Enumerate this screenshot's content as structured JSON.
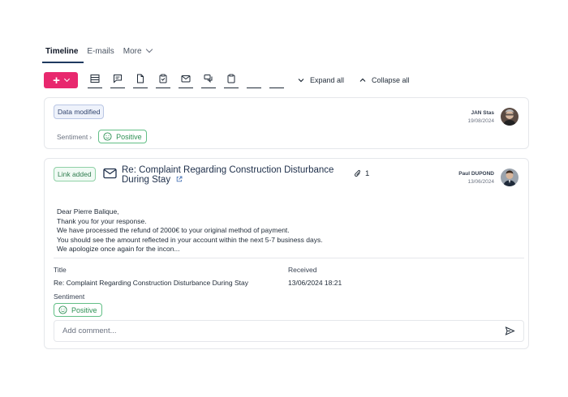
{
  "tabs": [
    {
      "label": "Timeline"
    },
    {
      "label": "E-mails"
    },
    {
      "label": "More"
    }
  ],
  "toolbar": {
    "expand_label": "Expand all",
    "collapse_label": "Collapse all"
  },
  "card1": {
    "badge": "Data modified",
    "author_name": "JAN Stas",
    "author_date": "19/08/2024",
    "sentiment_label": "Sentiment",
    "sentiment_value": "Positive"
  },
  "card2": {
    "badge": "Link added",
    "title_line1": "Re: Complaint Regarding Construction Disturbance",
    "title_line2": "During Stay",
    "attachments": "1",
    "author_name": "Paul DUPOND",
    "author_date": "13/06/2024",
    "body": [
      "Dear Pierre Balique,",
      "Thank you for your response.",
      "We have processed the refund of 2000€ to your original method of payment.",
      "You should see the amount reflected in your account within the next 5-7 business days.",
      "We apologize once again for the incon..."
    ],
    "title_label": "Title",
    "title_value": "Re: Complaint Regarding Construction Disturbance During Stay",
    "received_label": "Received",
    "received_value": "13/06/2024 18:21",
    "sentiment_label": "Sentiment",
    "sentiment_value": "Positive",
    "comment_placeholder": "Add comment..."
  },
  "colors": {
    "accent": "#e8286e",
    "positive": "#2f9155"
  }
}
